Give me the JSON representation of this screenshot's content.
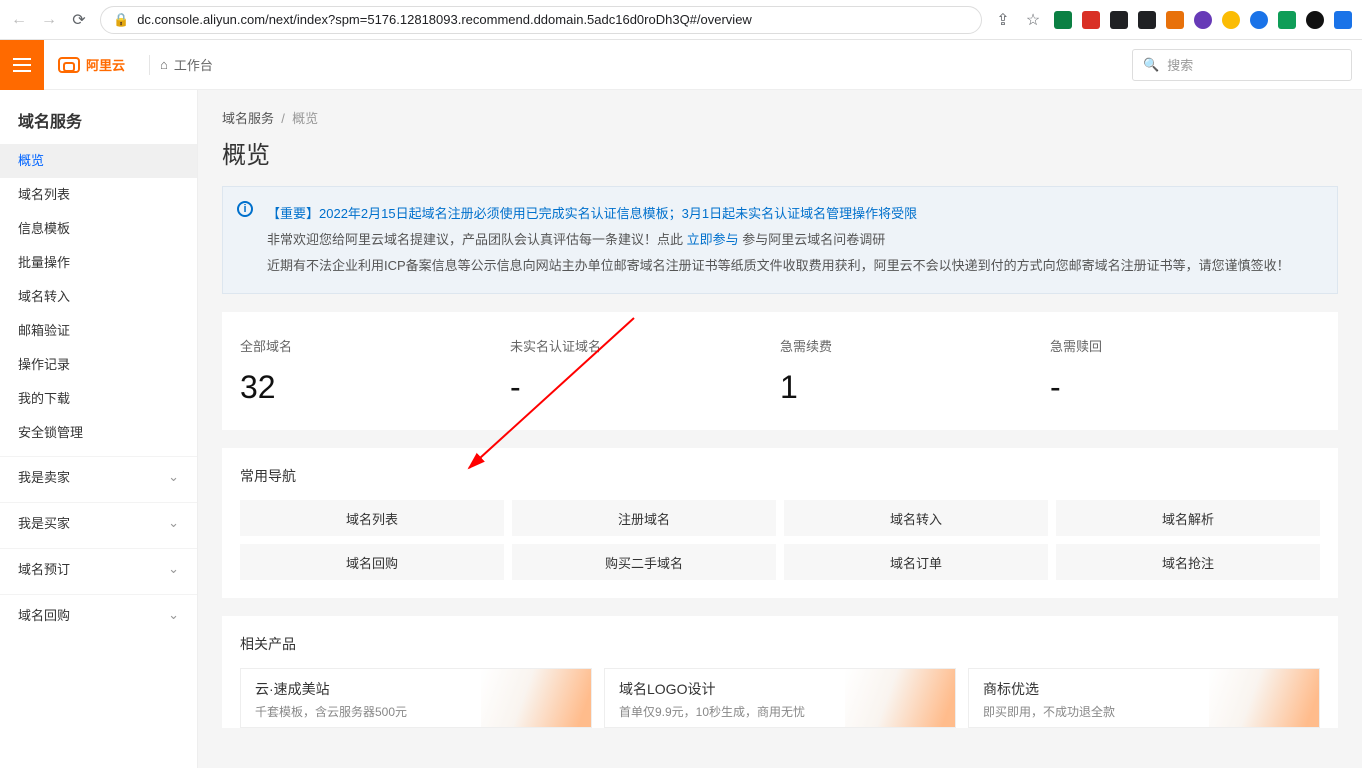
{
  "browser": {
    "url": "dc.console.aliyun.com/next/index?spm=5176.12818093.recommend.ddomain.5adc16d0roDh3Q#/overview"
  },
  "top": {
    "brand": "阿里云",
    "workbench": "工作台",
    "search_placeholder": "搜索"
  },
  "sidebar": {
    "title": "域名服务",
    "items": [
      "概览",
      "域名列表",
      "信息模板",
      "批量操作",
      "域名转入",
      "邮箱验证",
      "操作记录",
      "我的下载",
      "安全锁管理"
    ],
    "groups": [
      "我是卖家",
      "我是买家",
      "域名预订",
      "域名回购"
    ]
  },
  "crumb": {
    "a": "域名服务",
    "b": "概览"
  },
  "page_title": "概览",
  "notice": {
    "l1a": "【重要】2022年2月15日起域名注册必须使用已完成实名认证信息模板；3月1日起未实名认证域名管理操作将受限",
    "l2_pre": "非常欢迎您给阿里云域名提建议，产品团队会认真评估每一条建议！点此 ",
    "l2_link": "立即参与",
    "l2_post": " 参与阿里云域名问卷调研",
    "l3": "近期有不法企业利用ICP备案信息等公示信息向网站主办单位邮寄域名注册证书等纸质文件收取费用获利，阿里云不会以快递到付的方式向您邮寄域名注册证书等，请您谨慎签收！"
  },
  "stats": [
    {
      "label": "全部域名",
      "value": "32"
    },
    {
      "label": "未实名认证域名",
      "value": "-"
    },
    {
      "label": "急需续费",
      "value": "1"
    },
    {
      "label": "急需赎回",
      "value": "-"
    }
  ],
  "nav": {
    "title": "常用导航",
    "items": [
      "域名列表",
      "注册域名",
      "域名转入",
      "域名解析",
      "域名回购",
      "购买二手域名",
      "域名订单",
      "域名抢注"
    ]
  },
  "products": {
    "title": "相关产品",
    "items": [
      {
        "title": "云·速成美站",
        "sub": "千套模板，含云服务器500元"
      },
      {
        "title": "域名LOGO设计",
        "sub": "首单仅9.9元，10秒生成，商用无忧"
      },
      {
        "title": "商标优选",
        "sub": "即买即用，不成功退全款"
      }
    ]
  }
}
